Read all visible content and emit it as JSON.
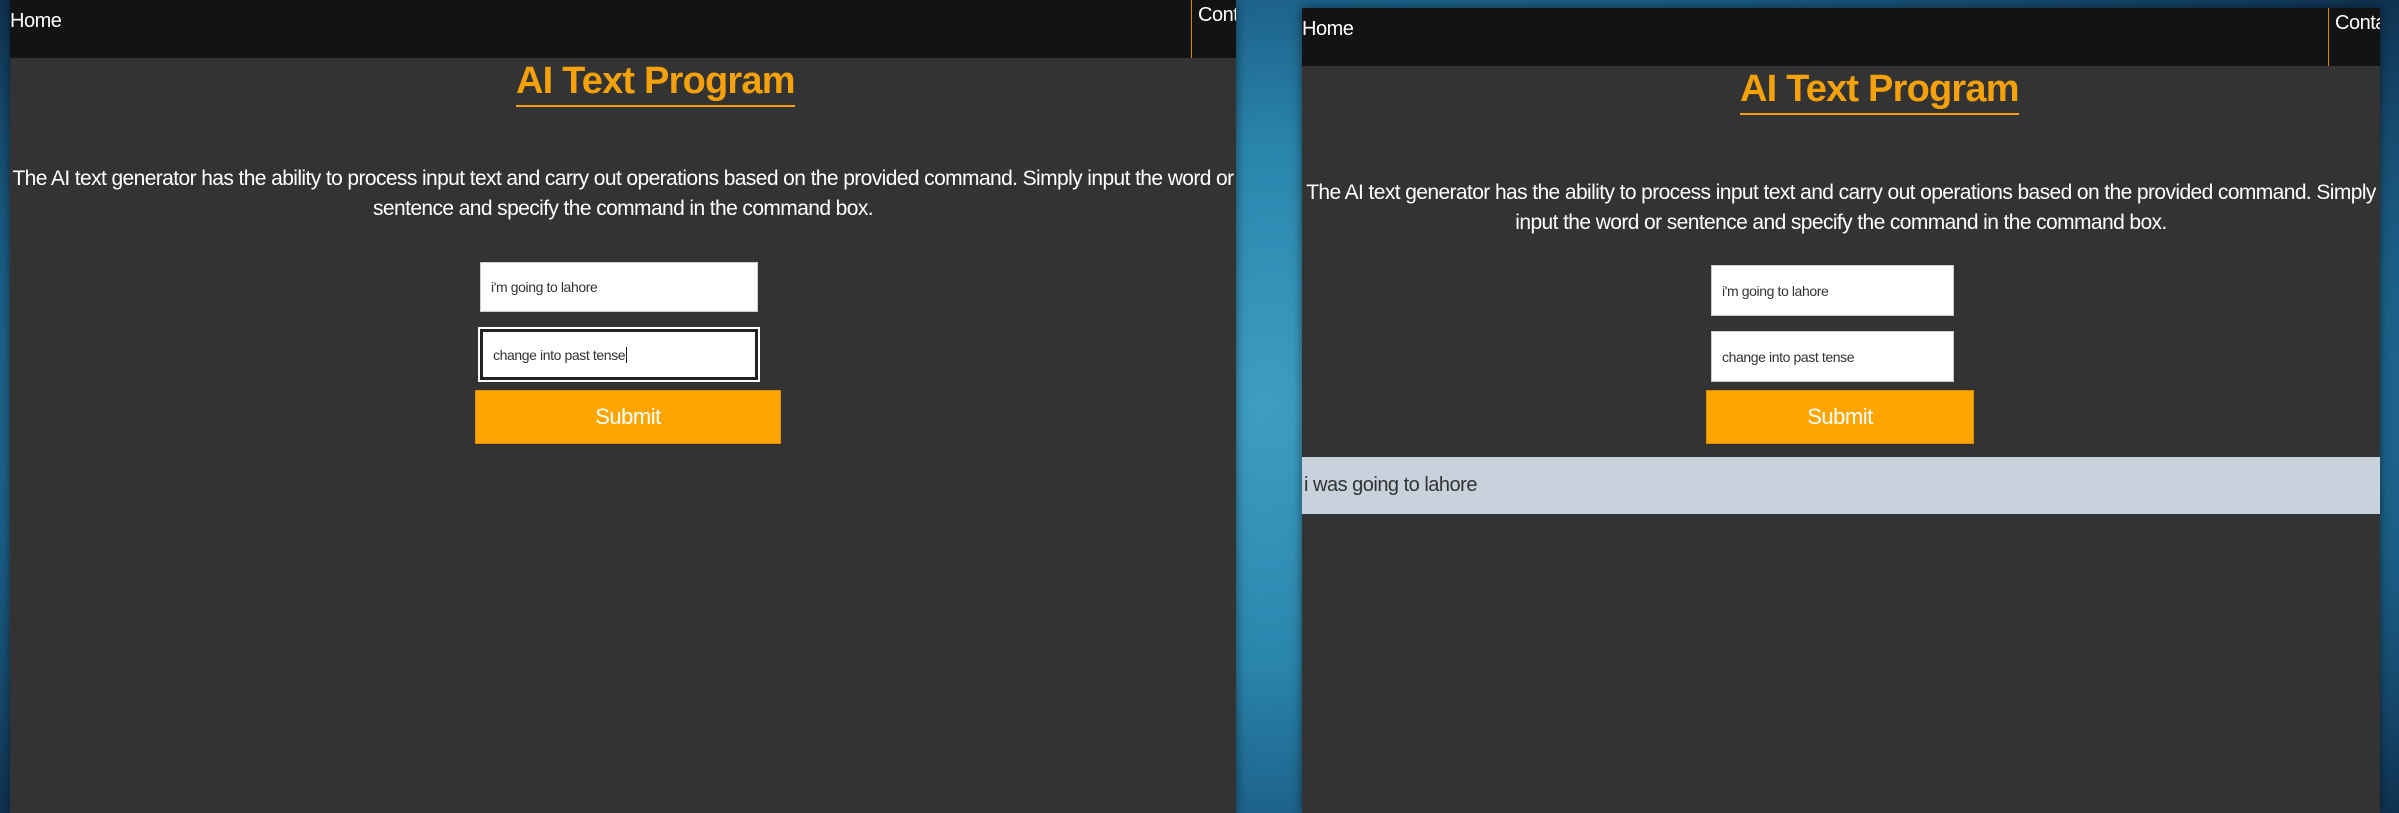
{
  "left_panel": {
    "nav": {
      "home": "Home",
      "contact": "Conta"
    },
    "title": "AI Text Program",
    "description": "The AI text generator has the ability to process input text and carry out operations based on the provided command. Simply input the word or sentence and specify the command in the command box.",
    "input_text": "i'm going to lahore",
    "input_command": "change into past tense",
    "submit_label": "Submit"
  },
  "right_panel": {
    "nav": {
      "home": "Home",
      "contact": "Contac"
    },
    "title": "AI Text Program",
    "description": "The AI text generator has the ability to process input text and carry out operations based on the provided command. Simply input the word or sentence and specify the command in the command box.",
    "input_text": "i'm going to lahore",
    "input_command": "change into past tense",
    "submit_label": "Submit",
    "result": "i was going to lahore"
  },
  "colors": {
    "accent": "#ffa500",
    "title": "#f5a10b",
    "panel_bg": "#333333",
    "navbar_bg": "#131313",
    "result_bg": "#c8d2dc"
  }
}
